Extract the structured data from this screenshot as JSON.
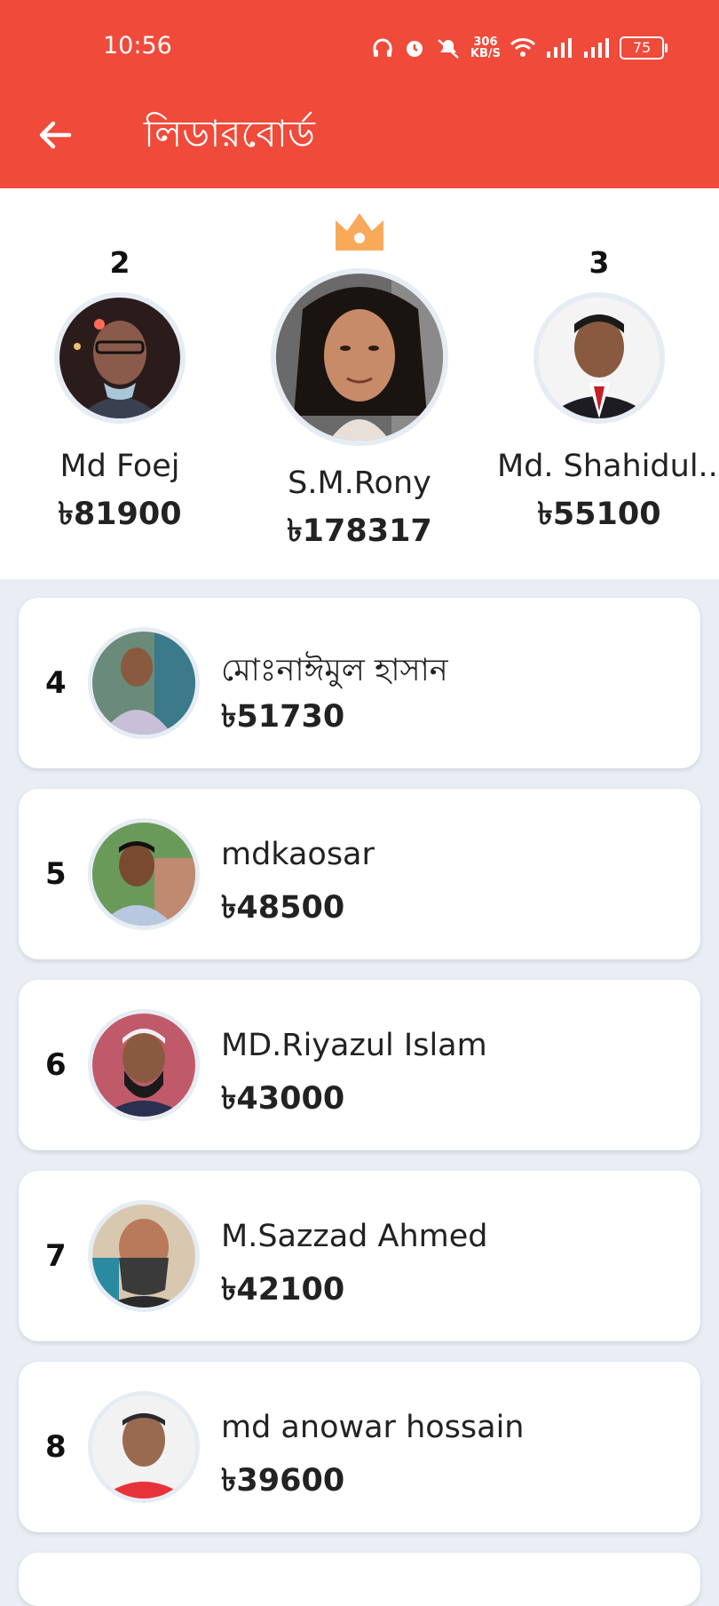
{
  "status_bar": {
    "time": "10:56",
    "net_speed_value": "306",
    "net_speed_unit": "KB/S",
    "battery": "75",
    "icons": [
      "headphones-icon",
      "alarm-icon",
      "mute-icon",
      "wifi-icon",
      "signal-icon",
      "signal-icon"
    ]
  },
  "app_bar": {
    "title": "লিডারবোর্ড",
    "back_icon": "arrow-left-icon",
    "color": "#f04a3a"
  },
  "podium": {
    "crown_icon": "crown-icon",
    "crown_color": "#f9a95a",
    "second": {
      "rank": "2",
      "name": "Md Foej",
      "amount": "৳81900"
    },
    "first": {
      "name": "S.M.Rony",
      "amount": "৳178317"
    },
    "third": {
      "rank": "3",
      "name": "Md. Shahidul..",
      "amount": "৳55100"
    }
  },
  "leaderboard": [
    {
      "rank": "4",
      "name": "মোঃনাঈমুল হাসান",
      "amount": "৳51730"
    },
    {
      "rank": "5",
      "name": "mdkaosar",
      "amount": "৳48500"
    },
    {
      "rank": "6",
      "name": "MD.Riyazul Islam",
      "amount": "৳43000"
    },
    {
      "rank": "7",
      "name": "M.Sazzad Ahmed",
      "amount": "৳42100"
    },
    {
      "rank": "8",
      "name": "md anowar hossain",
      "amount": "৳39600"
    }
  ]
}
